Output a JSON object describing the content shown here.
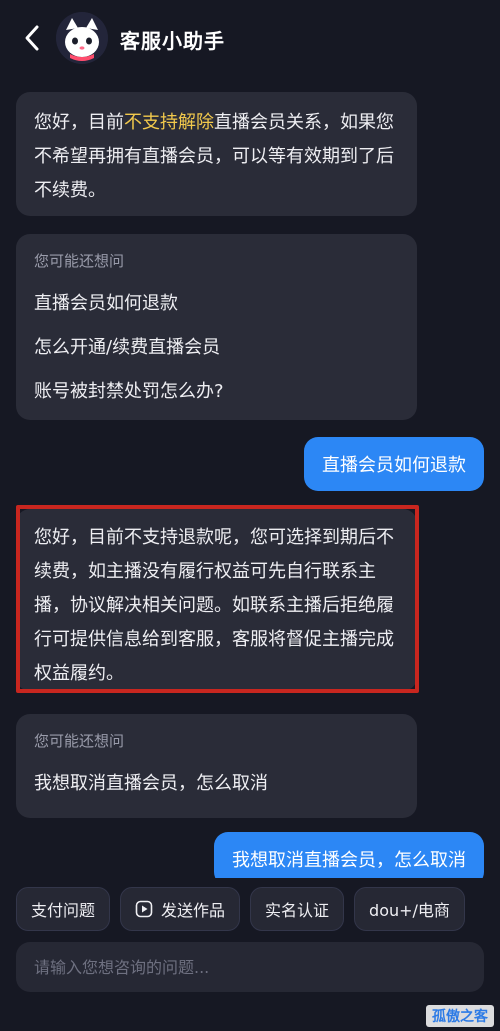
{
  "header": {
    "title": "客服小助手"
  },
  "messages": {
    "m1": {
      "pre": "您好，目前",
      "highlight": "不支持解除",
      "post": "直播会员关系，如果您不希望再拥有直播会员，可以等有效期到了后不续费。"
    },
    "suggest1": {
      "title": "您可能还想问",
      "items": [
        "直播会员如何退款",
        "怎么开通/续费直播会员",
        "账号被封禁处罚怎么办?"
      ]
    },
    "user1": "直播会员如何退款",
    "m2": "您好，目前不支持退款呢，您可选择到期后不续费，如主播没有履行权益可先自行联系主播，协议解决相关问题。如联系主播后拒绝履行可提供信息给到客服，客服将督促主播完成权益履约。",
    "suggest2": {
      "title": "您可能还想问",
      "items": [
        "我想取消直播会员，怎么取消"
      ]
    },
    "user2": "我想取消直播会员，怎么取消"
  },
  "quick_actions": [
    "支付问题",
    "发送作品",
    "实名认证",
    "dou+/电商"
  ],
  "input": {
    "placeholder": "请输入您想咨询的问题..."
  },
  "watermark": "孤傲之客",
  "colors": {
    "background": "#161823",
    "bot_bubble": "#2a2c38",
    "user_bubble": "#2c87f5",
    "highlight": "#f2c94c",
    "annotation_box": "#c8261f"
  }
}
